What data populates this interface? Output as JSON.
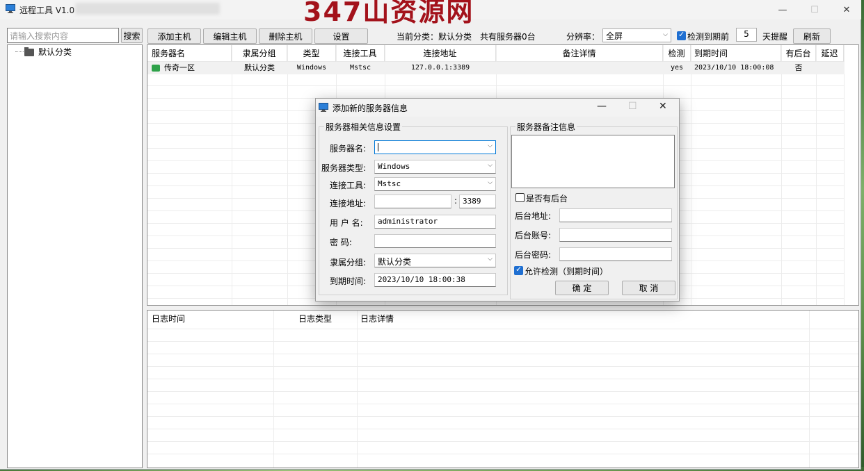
{
  "app": {
    "title": "远程工具 V1.0",
    "watermark": "347山资源网",
    "min_icon": "—",
    "max_icon": "☐",
    "close_icon": "✕"
  },
  "toolbar": {
    "search_placeholder": "请输入搜索内容",
    "search_btn": "搜索",
    "add_btn": "添加主机",
    "edit_btn": "编辑主机",
    "delete_btn": "删除主机",
    "settings_btn": "设置",
    "category_text": "当前分类：默认分类",
    "count_text": "共有服务器0台",
    "resolution_label": "分辨率：",
    "resolution_value": "全屏",
    "check_expiry_label": "检测到期前",
    "days_value": "5",
    "days_suffix": "天提醒",
    "refresh_btn": "刷新"
  },
  "tree": {
    "root": "默认分类"
  },
  "grid": {
    "headers": [
      "服务器名",
      "隶属分组",
      "类型",
      "连接工具",
      "连接地址",
      "备注详情",
      "检测",
      "到期时间",
      "有后台",
      "延迟"
    ],
    "rows": [
      {
        "name": "传奇一区",
        "group": "默认分类",
        "type": "Windows",
        "tool": "Mstsc",
        "address": "127.0.0.1:3389",
        "note": "",
        "check": "yes",
        "expiry": "2023/10/10 18:00:08",
        "backend": "否",
        "latency": ""
      }
    ]
  },
  "log": {
    "headers": [
      "日志时间",
      "日志类型",
      "日志详情"
    ]
  },
  "dialog": {
    "title": "添加新的服务器信息",
    "group_left": "服务器相关信息设置",
    "group_right": "服务器备注信息",
    "server_name_label": "服务器名:",
    "server_name_value": "",
    "server_type_label": "服务器类型:",
    "server_type_value": "Windows",
    "tool_label": "连接工具:",
    "tool_value": "Mstsc",
    "address_label": "连接地址:",
    "address_value": "",
    "port_sep": ":",
    "port_value": "3389",
    "username_label": "用 户 名:",
    "username_value": "administrator",
    "password_label": "密    码:",
    "password_value": "",
    "group_label": "隶属分组:",
    "group_value": "默认分类",
    "expiry_label": "到期时间:",
    "expiry_value": "2023/10/10 18:00:38",
    "has_backend_label": "是否有后台",
    "backend_url_label": "后台地址:",
    "backend_account_label": "后台账号:",
    "backend_password_label": "后台密码:",
    "allow_check_label": "允许检测（到期时间）",
    "ok_btn": "确  定",
    "cancel_btn": "取  消"
  }
}
